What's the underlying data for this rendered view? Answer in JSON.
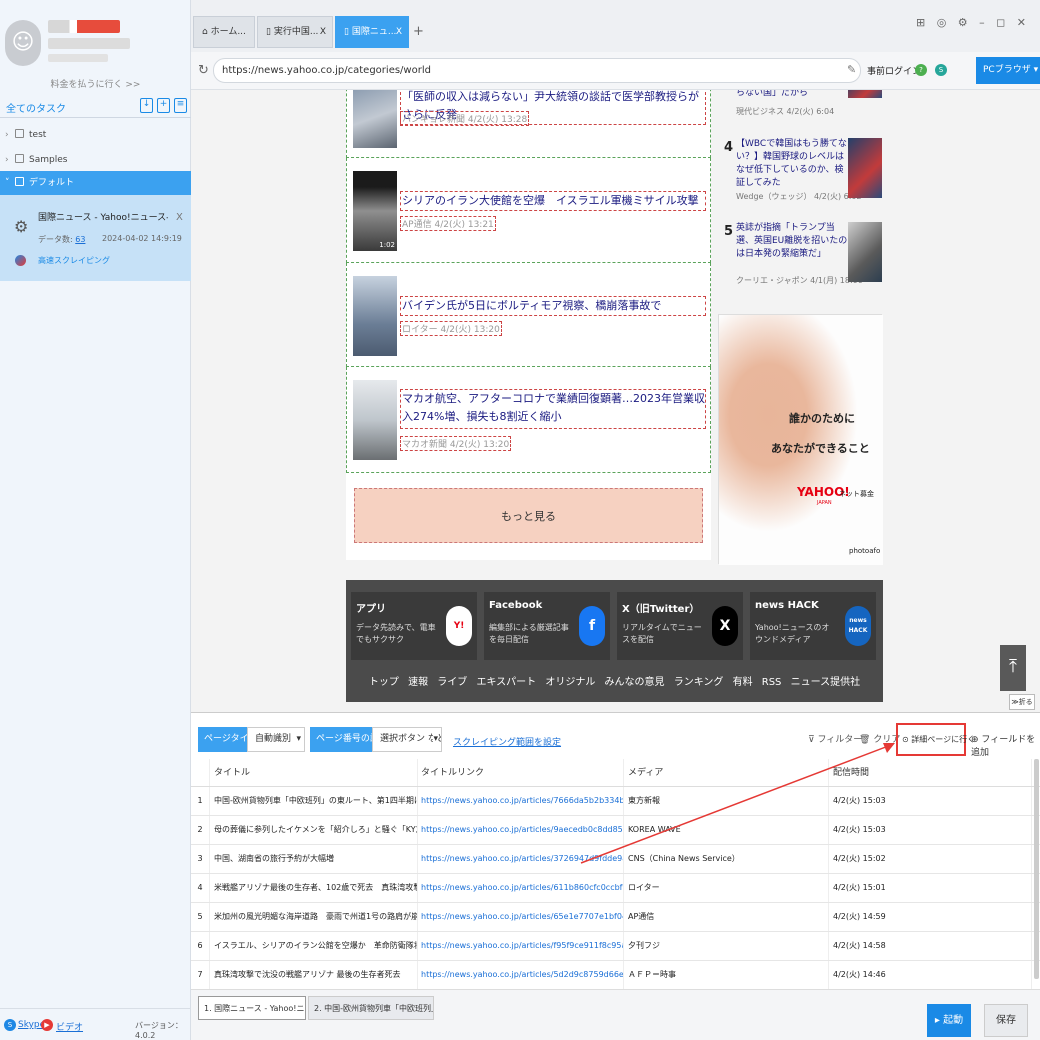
{
  "sidebar": {
    "pay_link": "料金を払うに行く >>",
    "all_tasks": "全てのタスク",
    "folders": [
      "test",
      "Samples",
      "デフォルト"
    ],
    "task": {
      "name": "国際ニュース - Yahoo!ニュース-スクレイピ...",
      "count_label": "データ数:",
      "count": "63",
      "date": "2024-04-02 14:9:19",
      "fast_label": "高速スクレイピング"
    },
    "skype": "Skype",
    "video": "ビデオ",
    "version": "バージョン：4.0.2"
  },
  "tabs": [
    {
      "label": "ホーム..."
    },
    {
      "label": "実行中国..."
    },
    {
      "label": "国際ニュ..."
    }
  ],
  "tab_close": "X",
  "url": "https://news.yahoo.co.jp/categories/world",
  "prelogin": "事前ログイン",
  "pc_browser": "PCブラウザ",
  "news": [
    {
      "title": "「医師の収入は減らない」尹大統領の談話で医学部教授らがさらに反発",
      "source": "ハンギョレ新聞",
      "time": "4/2(火) 13:28"
    },
    {
      "title": "シリアのイラン大使館を空爆　イスラエル軍機ミサイル攻撃",
      "source": "AP通信",
      "time": "4/2(火) 13:21",
      "duration": "1:02"
    },
    {
      "title": "バイデン氏が5日にボルティモア視察、橋崩落事故で",
      "source": "ロイター",
      "time": "4/2(火) 13:20"
    },
    {
      "title": "マカオ航空、アフターコロナで業績回復顕著…2023年営業収入274%増、損失も8割近く縮小",
      "source": "マカオ新聞",
      "time": "4/2(火) 13:20"
    }
  ],
  "more": "もっと見る",
  "ranking": [
    {
      "num": "",
      "title": "らない国」だから",
      "meta": "現代ビジネス 4/2(火) 6:04"
    },
    {
      "num": "4",
      "title": "【WBCで韓国はもう勝てない？】韓国野球のレベルはなぜ低下しているのか、検証してみた",
      "meta": "Wedge（ウェッジ） 4/2(火) 6:02"
    },
    {
      "num": "5",
      "title": "英誌が指摘「トランプ当選、英国EU離脱を招いたのは日本発の緊縮策だ」",
      "meta": "クーリエ・ジャポン 4/1(月) 18:00"
    }
  ],
  "ad": {
    "line1": "誰かのために",
    "line2": "あなたができること",
    "logo": "YAHOO!",
    "logo_sub": "ネット募金",
    "japan": "JAPAN",
    "credit": "photoafo"
  },
  "footer": {
    "cards": [
      {
        "title": "アプリ",
        "desc": "データ先読みで、電車でもサクサク",
        "icon": "Y!"
      },
      {
        "title": "Facebook",
        "desc": "編集部による厳選記事を毎日配信",
        "icon": "f"
      },
      {
        "title": "X（旧Twitter）",
        "desc": "リアルタイムでニュースを配信",
        "icon": "X"
      },
      {
        "title": "news HACK",
        "desc": "Yahoo!ニュースのオウンドメディア",
        "icon": "news HACK"
      }
    ],
    "links": "トップ 速報 ライブ エキスパート オリジナル みんなの意見 ランキング 有料 RSS ニュース提供社"
  },
  "fold": "≫折る",
  "panel": {
    "page_type_label": "ページタイプ",
    "page_type_value": "自動識別",
    "page_number_label": "ページ番号の設定",
    "page_number_value": "選択ボタン など...",
    "scrape_range": "スクレイピング範囲を設定",
    "filter": "フィルター",
    "clear": "クリア",
    "detail": "詳細ページに行く",
    "add_field": "フィールドを追加",
    "columns": [
      "タイトル",
      "タイトルリンク",
      "メディア",
      "配信時間"
    ],
    "rows": [
      {
        "n": "1",
        "title": "中国-欧州貨物列車「中欧班列」の東ルート、第1四半期に輸送量で...",
        "link": "https://news.yahoo.co.jp/articles/7666da5b2b334b7dae7ec2ddd56...",
        "media": "東方新報",
        "time": "4/2(火) 15:03"
      },
      {
        "n": "2",
        "title": "母の葬儀に参列したイケメンを「紹介しろ」と騒ぐ「KY友人」......",
        "link": "https://news.yahoo.co.jp/articles/9aecedb0c8dd85e8d11479aa7d7f...",
        "media": "KOREA WAVE",
        "time": "4/2(火) 15:03"
      },
      {
        "n": "3",
        "title": "中国、湖南省の旅行予約が大幅増",
        "link": "https://news.yahoo.co.jp/articles/3726947d9fdde9a04ccc8157cf5d1...",
        "media": "CNS（China News Service）",
        "time": "4/2(火) 15:02"
      },
      {
        "n": "4",
        "title": "米戦艦アリゾナ最後の生存者、102歳で死去　真珠湾攻撃で最大被害",
        "link": "https://news.yahoo.co.jp/articles/611b860cfc0ccbf792275334a317d...",
        "media": "ロイター",
        "time": "4/2(火) 15:01"
      },
      {
        "n": "5",
        "title": "米加州の風光明媚な海岸道路　豪雨で州道1号の路肩が崩落",
        "link": "https://news.yahoo.co.jp/articles/65e1e7707e1bf04a2a3bb099bdffb...",
        "media": "AP通信",
        "time": "4/2(火) 14:59"
      },
      {
        "n": "6",
        "title": "イスラエル、シリアのイラン公館を空爆か　革命防衛隊将官含む...",
        "link": "https://news.yahoo.co.jp/articles/f95f9ce911f8c95af3e8c6aa980637...",
        "media": "夕刊フジ",
        "time": "4/2(火) 14:58"
      },
      {
        "n": "7",
        "title": "真珠湾攻撃で沈没の戦艦アリゾナ 最後の生存者死去",
        "link": "https://news.yahoo.co.jp/articles/5d2d9c8759d66e2726356b954ee...",
        "media": "ＡＦＰ＝時事",
        "time": "4/2(火) 14:46"
      }
    ],
    "page_tabs": [
      "1. 国際ニュース - Yahoo!ニュース",
      "2. 中国-欧州貨物列車「中欧班列」..."
    ],
    "start": "起動",
    "save": "保存"
  }
}
